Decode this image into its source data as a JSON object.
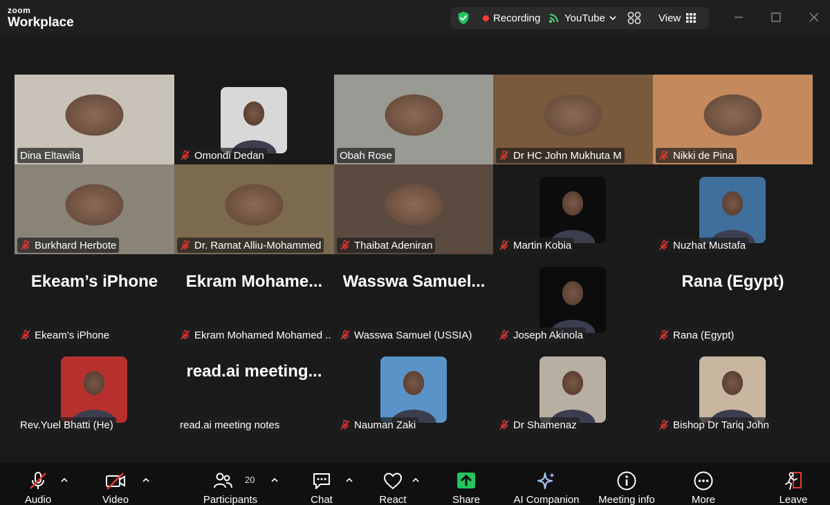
{
  "app": {
    "brand_top": "zoom",
    "brand_bottom": "Workplace"
  },
  "status": {
    "recording": "Recording",
    "stream": "YouTube",
    "view": "View"
  },
  "participants": [
    {
      "name": "Dina  Eltawila",
      "muted": false,
      "mode": "video",
      "bg": "#c9c2b8",
      "active": false
    },
    {
      "name": "Omondi Dedan",
      "muted": true,
      "mode": "avatar",
      "bg": "#d8d8d8"
    },
    {
      "name": "Obah Rose",
      "muted": false,
      "mode": "video",
      "bg": "#9a9a94",
      "active": true
    },
    {
      "name": "Dr HC John Mukhuta M",
      "muted": true,
      "mode": "video",
      "bg": "#7a5a3c"
    },
    {
      "name": "Nikki de Pina",
      "muted": true,
      "mode": "video",
      "bg": "#c48a5e"
    },
    {
      "name": "Burkhard Herbote",
      "muted": true,
      "mode": "video",
      "bg": "#8a8378"
    },
    {
      "name": "Dr. Ramat Alliu-Mohammed",
      "muted": true,
      "mode": "video",
      "bg": "#7c6a4e"
    },
    {
      "name": "Thaibat Adeniran",
      "muted": true,
      "mode": "video",
      "bg": "#5a4a40"
    },
    {
      "name": "Martin Kobia",
      "muted": true,
      "mode": "avatar",
      "bg": "#0d0d0d"
    },
    {
      "name": "Nuzhat Mustafa",
      "muted": true,
      "mode": "avatar",
      "bg": "#3f6f9c"
    },
    {
      "name": "Ekeam’s iPhone",
      "muted": true,
      "mode": "text",
      "display": "Ekeam’s iPhone"
    },
    {
      "name": "Ekram Mohamed Mohamed ...",
      "muted": true,
      "mode": "text",
      "display": "Ekram  Mohame..."
    },
    {
      "name": "Wasswa Samuel (USSIA)",
      "muted": true,
      "mode": "text",
      "display": "Wasswa  Samuel..."
    },
    {
      "name": "Joseph Akinola",
      "muted": true,
      "mode": "avatar",
      "bg": "#0b0b0b"
    },
    {
      "name": "Rana (Egypt)",
      "muted": true,
      "mode": "text",
      "display": "Rana (Egypt)"
    },
    {
      "name": "Rev.Yuel Bhatti (He)",
      "muted": false,
      "mode": "avatar",
      "bg": "#b8302e"
    },
    {
      "name": "read.ai meeting notes",
      "muted": false,
      "mode": "text",
      "display": "read.ai  meeting..."
    },
    {
      "name": "Nauman Zaki",
      "muted": true,
      "mode": "avatar",
      "bg": "#5a93c8"
    },
    {
      "name": "Dr Shamenaz",
      "muted": true,
      "mode": "avatar",
      "bg": "#b7b0a2"
    },
    {
      "name": "Bishop Dr Tariq John",
      "muted": true,
      "mode": "avatar",
      "bg": "#c8b6a0"
    }
  ],
  "toolbar": {
    "audio": "Audio",
    "video": "Video",
    "participants": "Participants",
    "participant_count": "20",
    "chat": "Chat",
    "react": "React",
    "share": "Share",
    "ai": "AI Companion",
    "info": "Meeting info",
    "more": "More",
    "leave": "Leave"
  },
  "colors": {
    "accent_green": "#22c55e",
    "record_red": "#ff3b30",
    "mute_red": "#e53935",
    "stream_green": "#4ade80"
  }
}
